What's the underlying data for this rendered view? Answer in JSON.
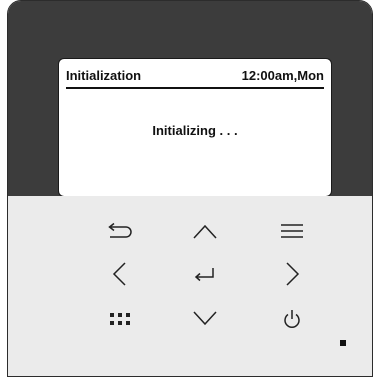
{
  "screen": {
    "title": "Initialization",
    "clock": "12:00am,Mon",
    "message": "Initializing . . ."
  },
  "keys": {
    "back": "back-icon",
    "up": "up-arrow-icon",
    "menu": "menu-icon",
    "left": "left-arrow-icon",
    "enter": "enter-icon",
    "right": "right-arrow-icon",
    "grid": "grid-icon",
    "down": "down-arrow-icon",
    "power": "power-icon"
  },
  "colors": {
    "bezel": "#3c3c3c",
    "panel": "#ebebeb",
    "ink": "#111111"
  }
}
